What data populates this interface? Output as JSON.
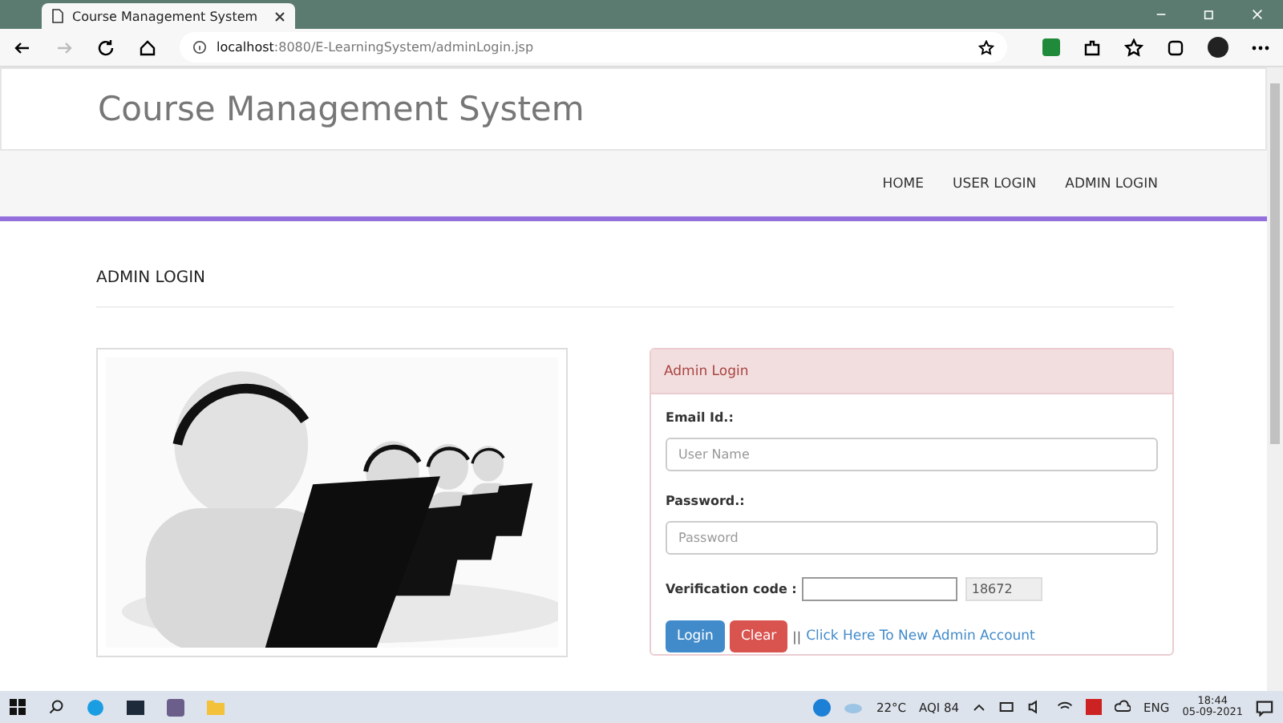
{
  "browser": {
    "tab_title": "Course Management System",
    "url_host": "localhost",
    "url_path": ":8080/E-LearningSystem/adminLogin.jsp"
  },
  "site": {
    "title": "Course Management System",
    "nav": [
      "HOME",
      "USER LOGIN",
      "ADMIN LOGIN"
    ]
  },
  "page_heading": "ADMIN LOGIN",
  "panel": {
    "title": "Admin Login",
    "fields": [
      {
        "label": "Email Id.:",
        "placeholder": "User Name"
      },
      {
        "label": "Password.:",
        "placeholder": "Password"
      }
    ],
    "verification": {
      "label": "Verification code :",
      "code": "18672"
    },
    "buttons": [
      {
        "label": "Login",
        "kind": "primary"
      },
      {
        "label": "Clear",
        "kind": "danger"
      }
    ],
    "separator": "||",
    "link": "Click Here To New Admin Account"
  },
  "taskbar": {
    "weather": "22°C",
    "aqi": "AQI 84",
    "language": "ENG",
    "time": "18:44",
    "date": "05-09-2021"
  }
}
